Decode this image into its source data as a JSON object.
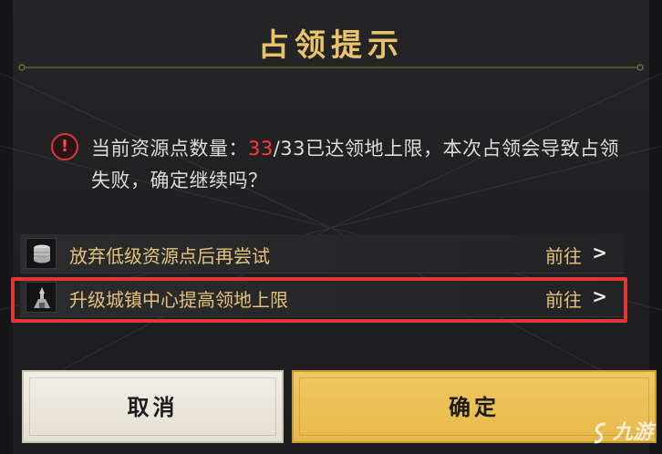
{
  "dialog": {
    "title": "占领提示",
    "message": {
      "prefix": "当前资源点数量：",
      "current": "33",
      "rest": "/33已达领地上限，本次占领会导致占领失败，确定继续吗？"
    },
    "options": [
      {
        "label": "放弃低级资源点后再尝试",
        "action": "前往",
        "icon": "coin-stack-icon"
      },
      {
        "label": "升级城镇中心提高领地上限",
        "action": "前往",
        "icon": "town-center-icon"
      }
    ],
    "buttons": {
      "cancel": "取消",
      "confirm": "确定"
    }
  },
  "watermark": {
    "text": "九游"
  },
  "colors": {
    "title": "#e8c36b",
    "warning": "#ff3b3b",
    "option_text": "#e2c37a",
    "highlight": "#e23636",
    "confirm_bg": "#e7b94a"
  }
}
